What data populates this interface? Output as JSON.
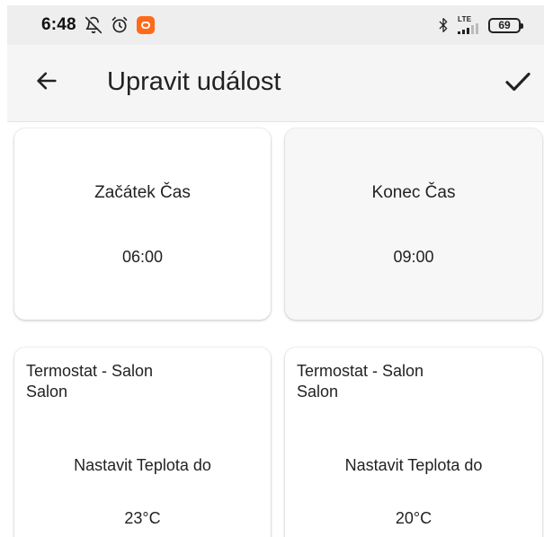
{
  "status_bar": {
    "time": "6:48",
    "icons": [
      "notifications-off-icon",
      "alarm-icon",
      "app-notification-icon"
    ],
    "right_icons": [
      "bluetooth-icon",
      "lte-signal-icon",
      "battery-icon"
    ],
    "network_label": "LTE",
    "battery_level": "69"
  },
  "app_bar": {
    "title": "Upravit událost",
    "back_icon": "arrow-left-icon",
    "save_icon": "check-icon"
  },
  "time_cards": [
    {
      "label": "Začátek Čas",
      "value": "06:00"
    },
    {
      "label": "Konec Čas",
      "value": "09:00"
    }
  ],
  "action_cards": [
    {
      "device": "Termostat - Salon",
      "room": "Salon",
      "action": "Nastavit Teplota do",
      "value": "23°C"
    },
    {
      "device": "Termostat - Salon",
      "room": "Salon",
      "action": "Nastavit Teplota do",
      "value": "20°C"
    }
  ],
  "colors": {
    "status_bar_bg": "#eeeeee",
    "app_bar_bg": "#f5f5f5",
    "card_bg": "#ffffff",
    "card_bg_alt": "#f7f7f7",
    "text": "#222222",
    "notification_badge": "#ff6a1a"
  }
}
